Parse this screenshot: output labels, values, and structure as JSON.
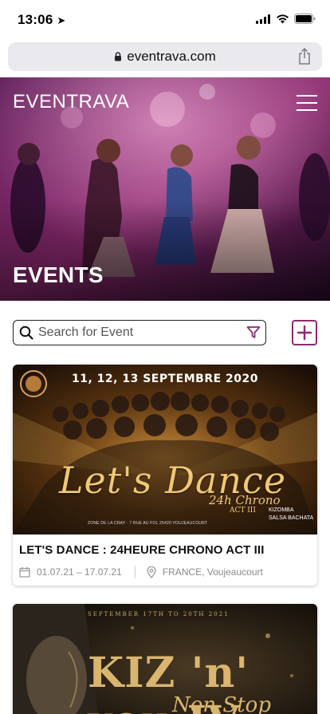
{
  "status_bar": {
    "time": "13:06"
  },
  "browser": {
    "url": "eventrava.com"
  },
  "header": {
    "logo": "EVENTRAVA",
    "page_title": "EVENTS"
  },
  "search": {
    "placeholder": "Search for Event",
    "value": ""
  },
  "colors": {
    "accent": "#8b2a6d",
    "text": "#111111",
    "meta": "#8a8a8a"
  },
  "events": [
    {
      "title": "LET'S DANCE : 24HEURE CHRONO ACT III",
      "date_range": "01.07.21 – 17.07.21",
      "location": "FRANCE, Voujeaucourt",
      "poster": {
        "dates": "11, 12, 13 SEPTEMBRE 2020",
        "headline": "Let's Dance",
        "subline": "24h Chrono",
        "act": "ACT III",
        "venue": "ZONE DE LA CRAY · 7 RUE AU FOL 25420 VOUJEAUCOURT",
        "tag_1": "KIZOMBA",
        "tag_2": "SALSA BACHATA"
      }
    },
    {
      "poster": {
        "dates": "SEPTEMBER 17TH TO 20TH 2021",
        "headline": "KIZ 'n' you IV",
        "subline": "Non Stop"
      }
    }
  ]
}
